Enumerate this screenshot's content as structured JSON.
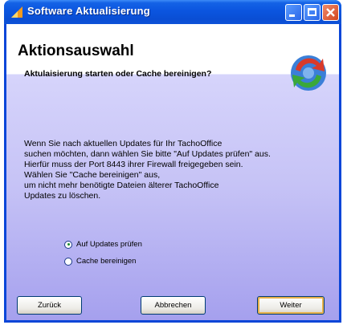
{
  "window": {
    "title": "Software Aktualisierung"
  },
  "header": {
    "title": "Aktionsauswahl",
    "subtitle": "Aktulaisierung starten oder Cache bereinigen?"
  },
  "body": {
    "lines": [
      "Wenn Sie nach aktuellen Updates für Ihr TachoOffice",
      "suchen möchten, dann wählen Sie bitte \"Auf Updates prüfen\" aus.",
      "Hierfür muss der Port 8443 ihrer Firewall freigegeben sein.",
      "Wählen Sie \"Cache bereinigen\" aus,",
      "um nicht mehr benötigte Dateien älterer TachoOffice",
      "Updates zu löschen."
    ]
  },
  "options": [
    {
      "label": "Auf Updates prüfen",
      "selected": true
    },
    {
      "label": "Cache bereinigen",
      "selected": false
    }
  ],
  "buttons": {
    "back": "Zurück",
    "cancel": "Abbrechen",
    "next": "Weiter"
  },
  "icons": {
    "app": "app-wizard-icon",
    "header": "update-sync-icon"
  },
  "colors": {
    "titlebar": "#0a55df",
    "accent_default_button": "#e8b14a",
    "gradient_bottom": "#a5a0ee"
  }
}
